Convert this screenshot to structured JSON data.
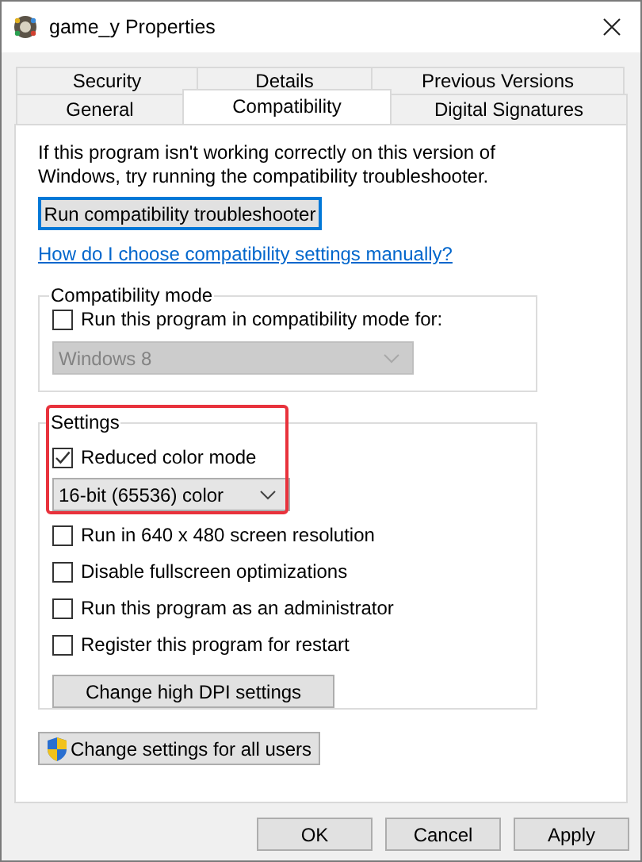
{
  "window": {
    "title": "game_y Properties"
  },
  "tab_rows": [
    [
      {
        "label": "Security",
        "selected": false
      },
      {
        "label": "Details",
        "selected": false
      },
      {
        "label": "Previous Versions",
        "selected": false
      }
    ],
    [
      {
        "label": "General",
        "selected": false
      },
      {
        "label": "Compatibility",
        "selected": true
      },
      {
        "label": "Digital Signatures",
        "selected": false
      }
    ]
  ],
  "intro": "If this program isn't working correctly on this version of Windows, try running the compatibility troubleshooter.",
  "troubleshooter_button": {
    "label": "Run compatibility troubleshooter",
    "focused": true
  },
  "help_link": "How do I choose compatibility settings manually?",
  "groups": [
    {
      "title": "Compatibility mode",
      "highlighted": false,
      "items": [
        {
          "kind": "checkbox",
          "label": "Run this program in compatibility mode for:",
          "checked": false
        },
        {
          "kind": "dropdown",
          "value": "Windows 8",
          "disabled": true
        }
      ]
    },
    {
      "title": "Settings",
      "highlighted": true,
      "items": [
        {
          "kind": "checkbox",
          "label": "Reduced color mode",
          "checked": true
        },
        {
          "kind": "dropdown",
          "value": "16-bit (65536) color",
          "disabled": false
        },
        {
          "kind": "checkbox",
          "label": "Run in 640 x 480 screen resolution",
          "checked": false
        },
        {
          "kind": "checkbox",
          "label": "Disable fullscreen optimizations",
          "checked": false
        },
        {
          "kind": "checkbox",
          "label": "Run this program as an administrator",
          "checked": false
        },
        {
          "kind": "checkbox",
          "label": "Register this program for restart",
          "checked": false
        },
        {
          "kind": "button",
          "label": "Change high DPI settings"
        }
      ]
    }
  ],
  "all_users_button": {
    "label": "Change settings for all users"
  },
  "dialog_buttons": [
    "OK",
    "Cancel",
    "Apply"
  ]
}
